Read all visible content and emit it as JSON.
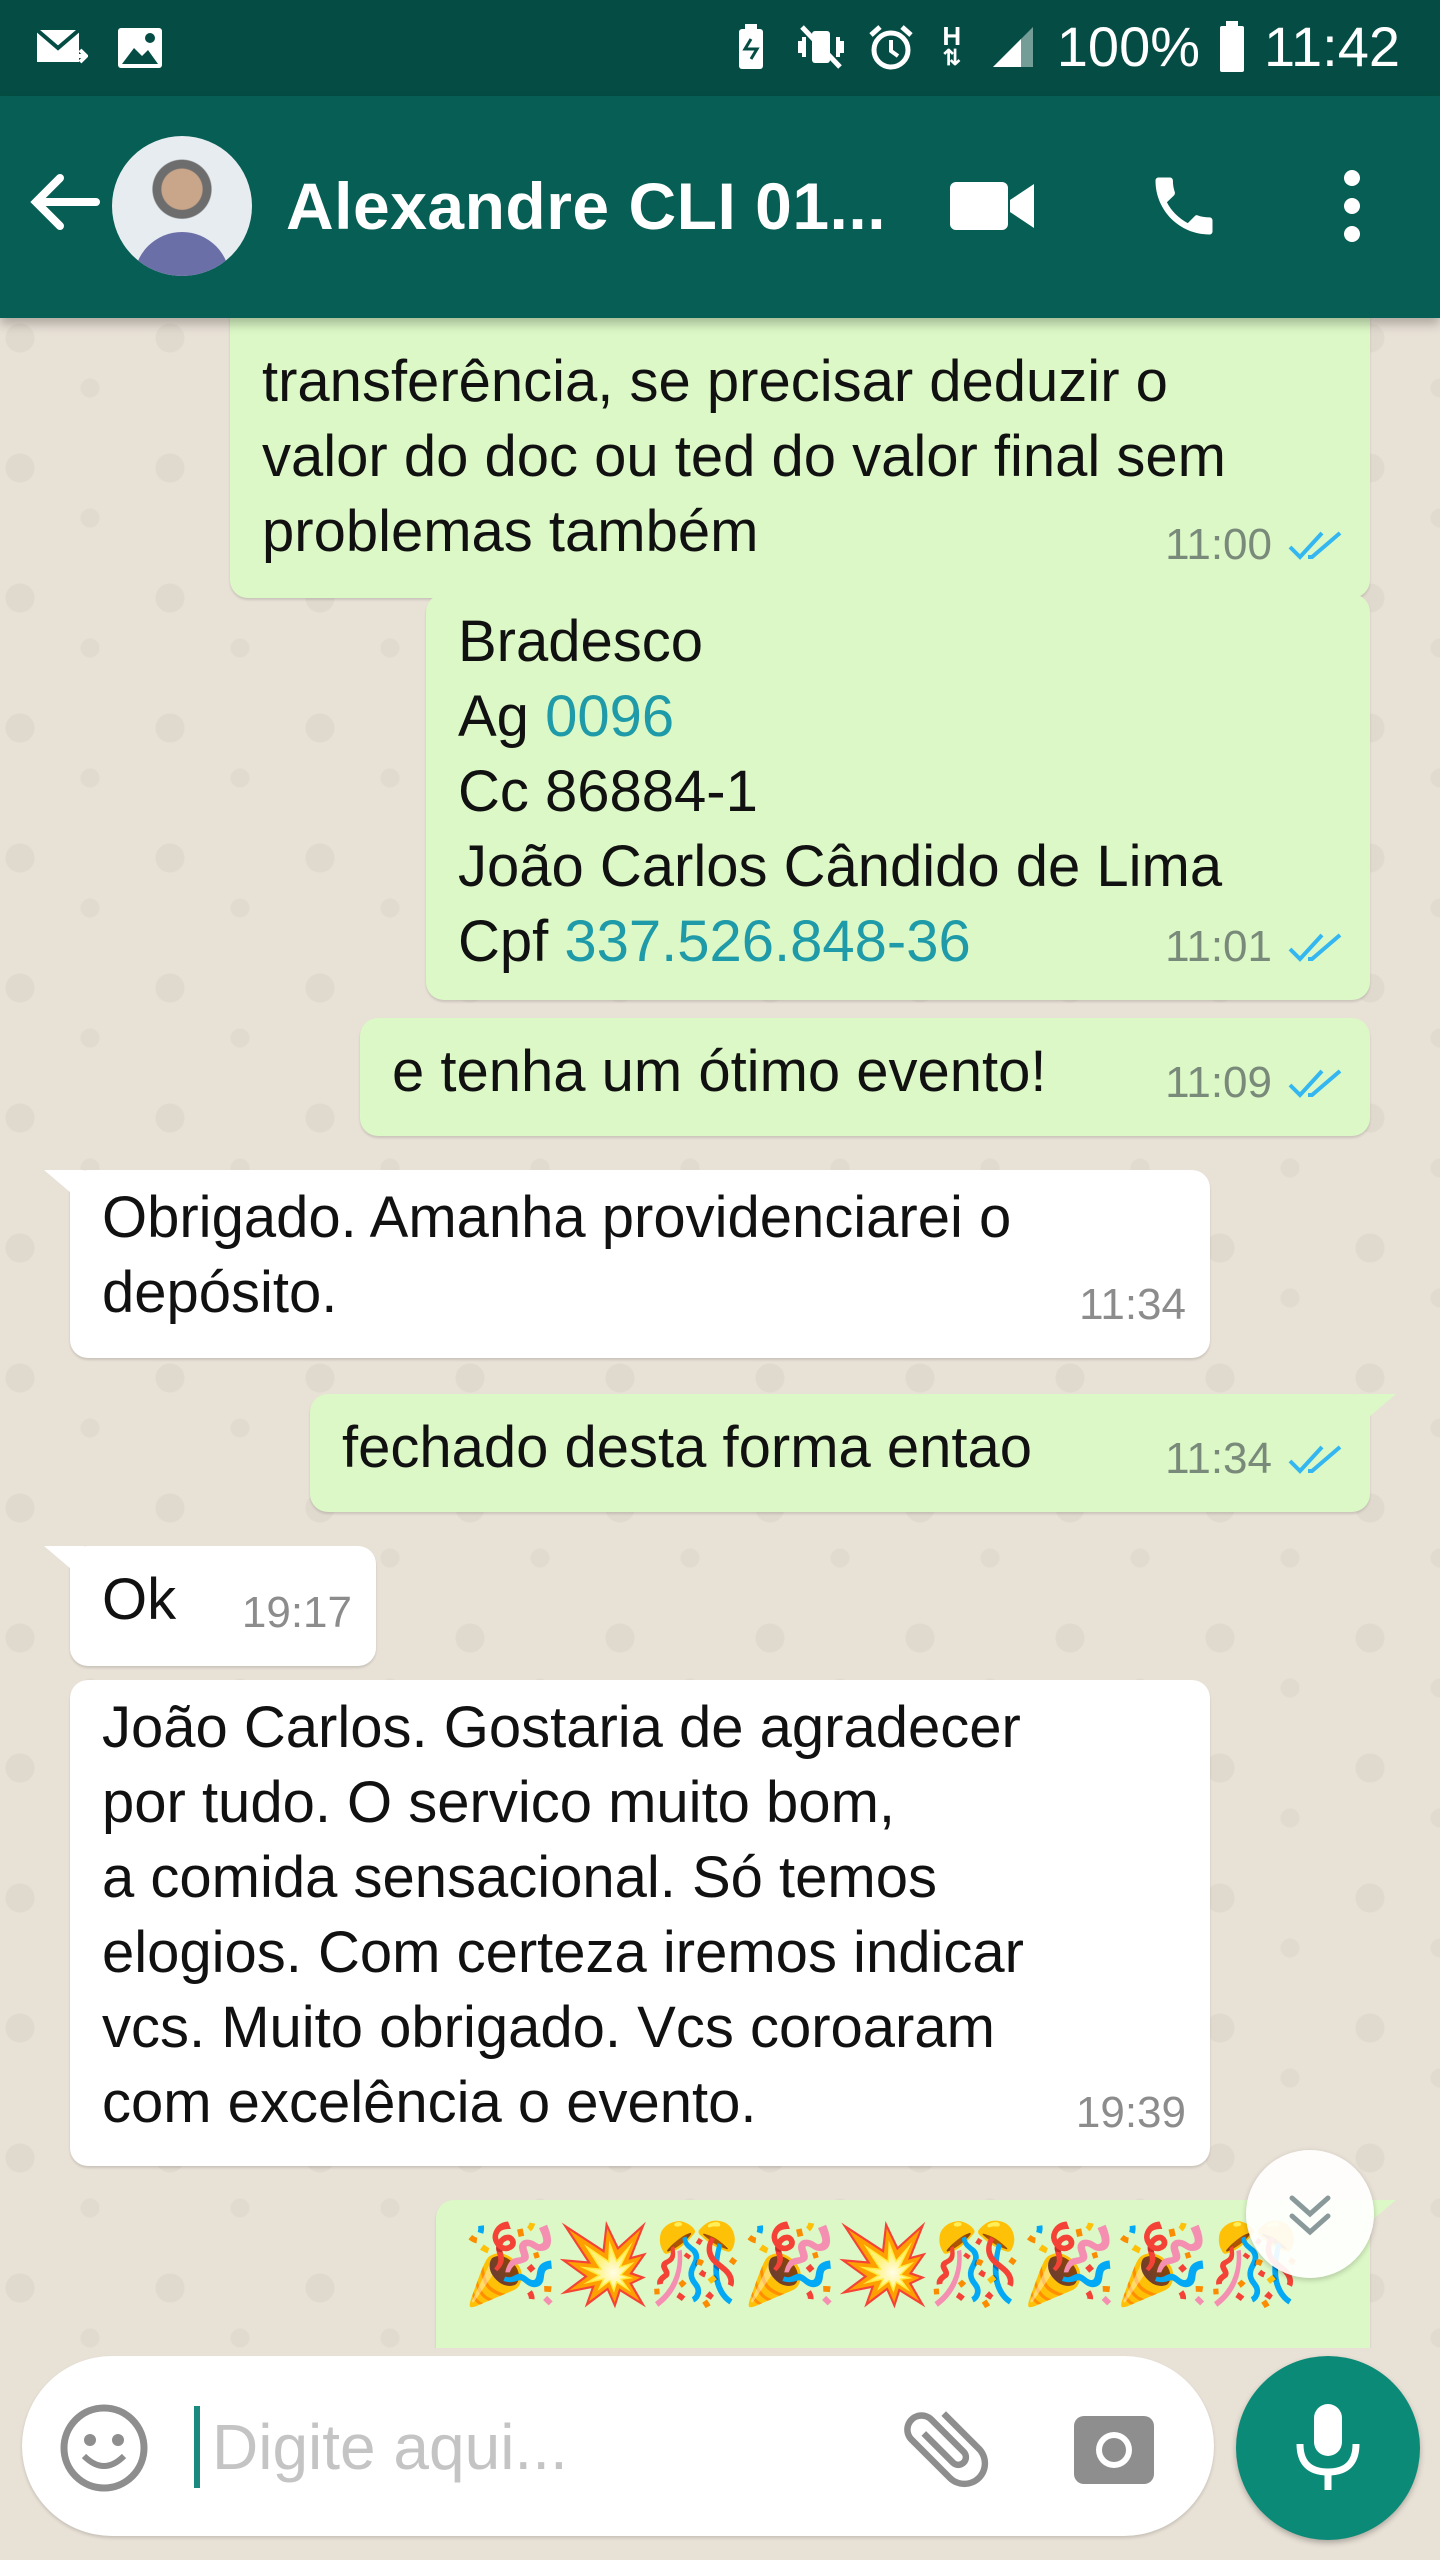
{
  "status_bar": {
    "battery": "100%",
    "time": "11:42",
    "network": "H"
  },
  "header": {
    "contact_name": "Alexandre CLI 01..."
  },
  "messages": [
    {
      "dir": "out",
      "text": "transferência, se precisar deduzir o\nvalor do doc ou ted do valor final sem\nproblemas também",
      "time": "11:00",
      "read": true
    },
    {
      "dir": "out",
      "lines": [
        {
          "text": "Bradesco",
          "link": ""
        },
        {
          "text": "Ag ",
          "link": "0096"
        },
        {
          "text": "Cc 86884-1",
          "link": ""
        },
        {
          "text": "João Carlos Cândido de Lima",
          "link": ""
        },
        {
          "text": "Cpf ",
          "link": "337.526.848-36"
        }
      ],
      "time": "11:01",
      "read": true
    },
    {
      "dir": "out",
      "text": "e tenha um ótimo evento!",
      "time": "11:09",
      "read": true
    },
    {
      "dir": "in",
      "text": "Obrigado. Amanha providenciarei o\ndepósito.",
      "time": "11:34"
    },
    {
      "dir": "out",
      "text": "fechado desta forma entao",
      "time": "11:34",
      "read": true
    },
    {
      "dir": "in",
      "text": "Ok",
      "time": "19:17"
    },
    {
      "dir": "in",
      "text": "João Carlos. Gostaria de agradecer\npor tudo. O servico muito bom,\na comida sensacional. Só temos\nelogios. Com certeza iremos indicar\nvcs. Muito obrigado. Vcs coroaram\ncom excelência o evento.",
      "time": "19:39"
    },
    {
      "dir": "out",
      "text": "🎉💥🎊🎉💥🎊🎉🎉🎊",
      "time": ""
    }
  ],
  "composer": {
    "placeholder": "Digite aqui..."
  },
  "colors": {
    "header": "#075e54",
    "status_bar": "#054d44",
    "outgoing_bubble": "#dcf8c6",
    "incoming_bubble": "#ffffff",
    "link": "#1e9aa8",
    "read_ticks": "#34b7f1",
    "mic_button": "#0b8a78"
  },
  "icons": [
    "back-arrow-icon",
    "video-call-icon",
    "phone-icon",
    "more-vert-icon",
    "emoji-icon",
    "attach-icon",
    "camera-icon",
    "mic-icon",
    "chevron-down-icon",
    "double-check-icon"
  ]
}
